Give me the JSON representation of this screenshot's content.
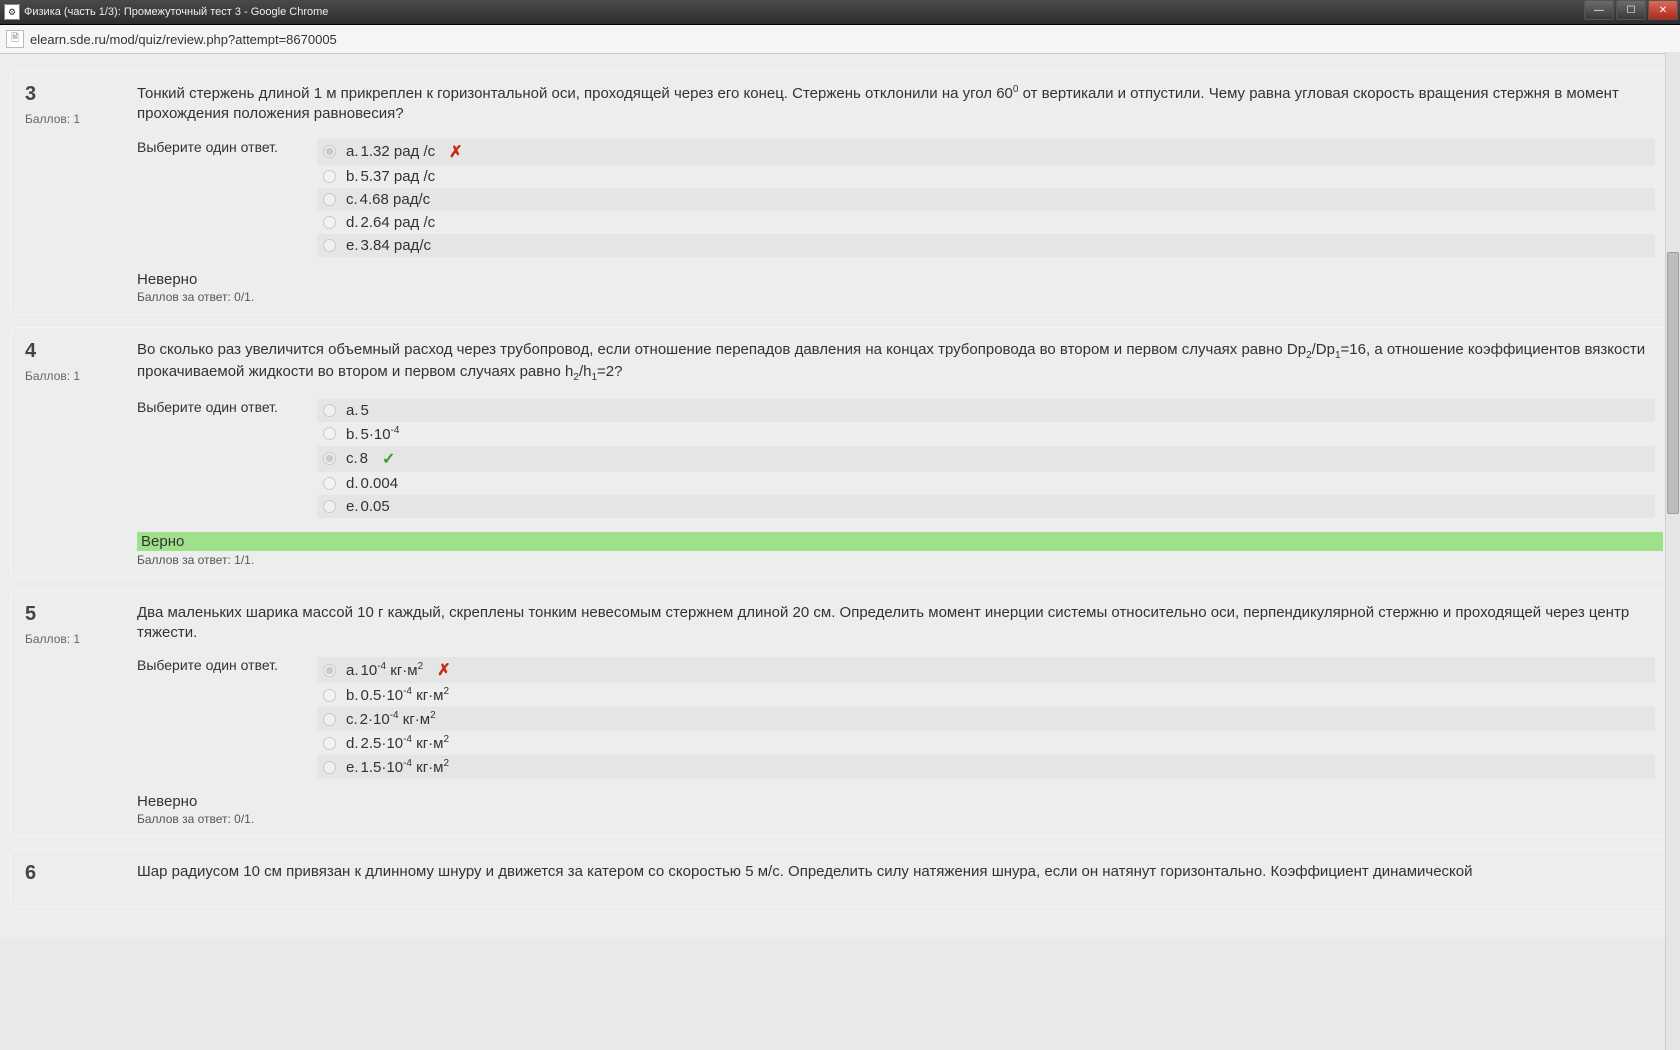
{
  "window": {
    "title": "Физика (часть 1/3): Промежуточный тест 3 - Google Chrome",
    "url": "elearn.sde.ru/mod/quiz/review.php?attempt=8670005"
  },
  "labels": {
    "score_prefix": "Баллов: ",
    "prompt": "Выберите один ответ.",
    "grade_prefix": "Баллов за ответ: ",
    "wrong": "Неверно",
    "right": "Верно"
  },
  "questions": [
    {
      "num": "3",
      "score": "1",
      "text_html": "Тонкий стержень длиной 1 м прикреплен к горизонтальной оси, проходящей через его конец. Стержень отклонили на угол 60<sup>0</sup> от вертикали и отпустили. Чему равна угловая скорость вращения стержня в момент прохождения положения равновесия?",
      "answers": [
        {
          "l": "a.",
          "t": "1.32 рад /с",
          "sel": true,
          "mark": "wrong"
        },
        {
          "l": "b.",
          "t": "5.37 рад /с"
        },
        {
          "l": "c.",
          "t": "4.68 рад/с"
        },
        {
          "l": "d.",
          "t": "2.64 рад /с"
        },
        {
          "l": "e.",
          "t": "3.84 рад/с"
        }
      ],
      "result": "wrong",
      "grade": "0/1."
    },
    {
      "num": "4",
      "score": "1",
      "text_html": "Во сколько раз увеличится объемный расход через трубопровод, если отношение перепадов давления на концах трубопровода во втором и первом случаях равно Dp<sub>2</sub>/Dp<sub>1</sub>=16, а отношение коэффициентов вязкости прокачиваемой жидкости во втором и первом случаях равно h<sub>2</sub>/h<sub>1</sub>=2?",
      "answers": [
        {
          "l": "a.",
          "t": "5"
        },
        {
          "l": "b.",
          "t_html": "5·10<sup>-4</sup>"
        },
        {
          "l": "c.",
          "t": "8",
          "sel": true,
          "mark": "right"
        },
        {
          "l": "d.",
          "t": "0.004"
        },
        {
          "l": "e.",
          "t": "0.05"
        }
      ],
      "result": "right",
      "grade": "1/1."
    },
    {
      "num": "5",
      "score": "1",
      "text_html": "Два маленьких шарика массой 10 г каждый, скреплены тонким невесомым стержнем длиной 20 см. Определить момент инерции системы относительно оси, перпендикулярной стержню и проходящей через центр тяжести.",
      "answers": [
        {
          "l": "a.",
          "t_html": "10<sup>-4</sup> кг·м<sup>2</sup>",
          "sel": true,
          "mark": "wrong"
        },
        {
          "l": "b.",
          "t_html": "0.5·10<sup>-4</sup> кг·м<sup>2</sup>"
        },
        {
          "l": "c.",
          "t_html": "2·10<sup>-4</sup> кг·м<sup>2</sup>"
        },
        {
          "l": "d.",
          "t_html": "2.5·10<sup>-4</sup> кг·м<sup>2</sup>"
        },
        {
          "l": "e.",
          "t_html": "1.5·10<sup>-4</sup> кг·м<sup>2</sup>"
        }
      ],
      "result": "wrong",
      "grade": "0/1."
    },
    {
      "num": "6",
      "score": "",
      "text_html": "Шар радиусом 10 см привязан к длинному шнуру и движется за катером со скоростью 5 м/с. Определить силу натяжения шнура, если он натянут горизонтально. Коэффициент динамической",
      "answers": [],
      "partial": true
    }
  ]
}
